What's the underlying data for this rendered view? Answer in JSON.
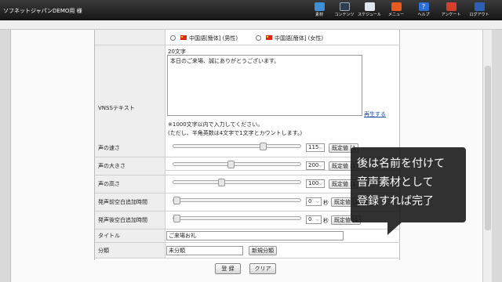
{
  "app": {
    "title": "ソフネットジャパンDEMO用 様"
  },
  "toolbar": [
    {
      "label": "素材",
      "color": "#3d8fd8"
    },
    {
      "label": "コンテンツ",
      "color": "#2c3e50"
    },
    {
      "label": "スケジュール",
      "color": "#dfe6ee"
    },
    {
      "label": "メニュー",
      "color": "#e85a1e"
    },
    {
      "label": "ヘルプ",
      "color": "#2d6fd2"
    },
    {
      "label": "アンケート",
      "color": "#d5402a"
    },
    {
      "label": "ログアウト",
      "color": "#2b5fb8"
    }
  ],
  "voice": {
    "options": [
      {
        "flag": "china-flag-icon",
        "label": "中国語[簡体] (男性)"
      },
      {
        "flag": "china-flag-icon",
        "label": "中国語[簡体] (女性)"
      }
    ]
  },
  "vnss": {
    "label": "VNSSテキスト",
    "count": "20文字",
    "text": "本日のご来場、誠にありがとうございます。",
    "play_link": "再生する",
    "note1": "※1000文字以内で入力してください。",
    "note2": "(ただし、半角英数は4文字で1文字とカウントします。)"
  },
  "sliders": [
    {
      "label": "声の速さ",
      "value": "115",
      "level": 0.72
    },
    {
      "label": "声の大きさ",
      "value": "200",
      "level": 0.45
    },
    {
      "label": "声の高さ",
      "value": "100",
      "level": 0.37
    },
    {
      "label": "発声前空白追加時間",
      "value": "0",
      "level": 0.0
    },
    {
      "label": "発声後空白追加時間",
      "value": "0",
      "level": 0.0
    }
  ],
  "default_button": "既定値 [1",
  "unit_sec": "秒",
  "title_row": {
    "label": "タイトル",
    "value": "ご来場お礼"
  },
  "category_row": {
    "label": "分類",
    "value": "未分類",
    "new_button": "新規分類"
  },
  "actions": {
    "register": "登 録",
    "clear": "クリア"
  },
  "caption": {
    "lines": [
      "後は名前を付けて",
      "音声素材として",
      "登録すれば完了"
    ]
  }
}
